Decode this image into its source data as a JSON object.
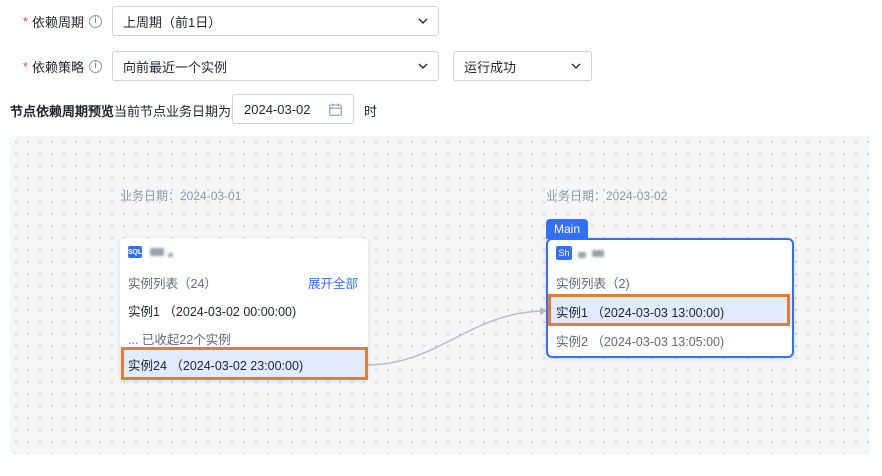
{
  "form": {
    "dependency_cycle": {
      "label": "依赖周期",
      "value": "上周期（前1日）"
    },
    "dependency_strategy": {
      "label": "依赖策略",
      "value": "向前最近一个实例",
      "status_value": "运行成功"
    },
    "required_mark": "*",
    "info_glyph": "i"
  },
  "preview": {
    "title": "节点依赖周期预览",
    "hint": "当前节点业务日期为",
    "date_value": "2024-03-02",
    "suffix": "时"
  },
  "canvas": {
    "upstream": {
      "biz_date": "业务日期：2024-03-01",
      "badge": "SQL",
      "list_title": "实例列表（24）",
      "expand_label": "展开全部",
      "instances": [
        "实例1 （2024-03-02 00:00:00)",
        "... 已收起22个实例",
        "实例24 （2024-03-02 23:00:00)"
      ]
    },
    "current": {
      "biz_date": "业务日期：2024-03-02",
      "tag": "Main",
      "badge": "Sh",
      "list_title": "实例列表（2)",
      "instances": [
        "实例1 （2024-03-03 13:00:00)",
        "实例2 （2024-03-03 13:05:00)"
      ]
    }
  },
  "colors": {
    "accent": "#3370ff",
    "highlight_box": "#ed7a26",
    "selected_row": "#e1eaff",
    "required": "#f54a45"
  }
}
